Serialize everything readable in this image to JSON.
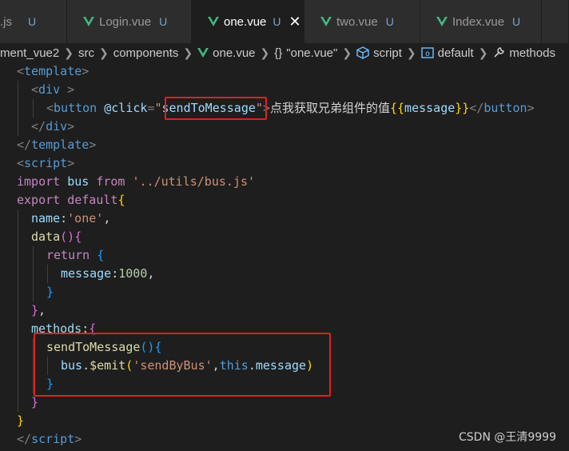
{
  "tabs": [
    {
      "name": ".js",
      "status": "U"
    },
    {
      "name": "Login.vue",
      "status": "U"
    },
    {
      "name": "one.vue",
      "status": "U",
      "close": "✕"
    },
    {
      "name": "two.vue",
      "status": "U"
    },
    {
      "name": "Index.vue",
      "status": "U"
    }
  ],
  "breadcrumb": {
    "items": [
      "ment_vue2",
      "src",
      "components",
      "one.vue",
      "\"one.vue\"",
      "script",
      "default",
      "methods"
    ],
    "icons": [
      "",
      "",
      "",
      "vue-icon",
      "braces-icon",
      "cube-icon",
      "object-icon",
      "wrench-icon"
    ]
  },
  "code": {
    "l1": {
      "a": "<",
      "b": "template",
      "c": ">"
    },
    "l2": {
      "a": "<",
      "b": "div",
      "c": " >"
    },
    "l3": {
      "a": "<",
      "b": "button",
      "c": " ",
      "d": "@click",
      "e": "=",
      "f": "\"",
      "g": "sendToMessage",
      "h": "\"",
      "i": ">",
      "j": "点我获取兄弟组件的值",
      "k": "{{",
      "l": "message",
      "m": "}}",
      "n": "</",
      "o": "button",
      "p": ">"
    },
    "l4": {
      "a": "</",
      "b": "div",
      "c": ">"
    },
    "l5": {
      "a": "</",
      "b": "template",
      "c": ">"
    },
    "l6": {
      "a": "<",
      "b": "script",
      "c": ">"
    },
    "l7": {
      "a": "import",
      "b": " bus ",
      "c": "from",
      "d": " ",
      "e": "'../utils/bus.js'"
    },
    "l8": {
      "a": "export",
      "b": " ",
      "c": "default",
      "d": "{"
    },
    "l9": {
      "a": "name",
      "b": ":",
      "c": "'one'",
      "d": ","
    },
    "l10": {
      "a": "data",
      "b": "()",
      "c": "{"
    },
    "l11": {
      "a": "return",
      "b": " ",
      "c": "{"
    },
    "l12": {
      "a": "message",
      "b": ":",
      "c": "1000",
      "d": ","
    },
    "l13": {
      "a": "}"
    },
    "l14": {
      "a": "}",
      "b": ","
    },
    "l15": {
      "a": "methods",
      "b": ":",
      "c": "{"
    },
    "l16": {
      "a": "sendToMessage",
      "b": "()",
      "c": "{"
    },
    "l17": {
      "a": "bus",
      "b": ".",
      "c": "$emit",
      "d": "(",
      "e": "'sendByBus'",
      "f": ",",
      "g": "this",
      "h": ".",
      "i": "message",
      "j": ")"
    },
    "l18": {
      "a": "}"
    },
    "l19": {
      "a": "}"
    },
    "l20": {
      "a": "}"
    },
    "l21": {
      "a": "</",
      "b": "script",
      "c": ">"
    }
  },
  "watermark": "CSDN @王清9999",
  "colors": {
    "vue_green": "#42b883",
    "highlight_red": "#e02020",
    "editor_bg": "#1e1e1e"
  }
}
